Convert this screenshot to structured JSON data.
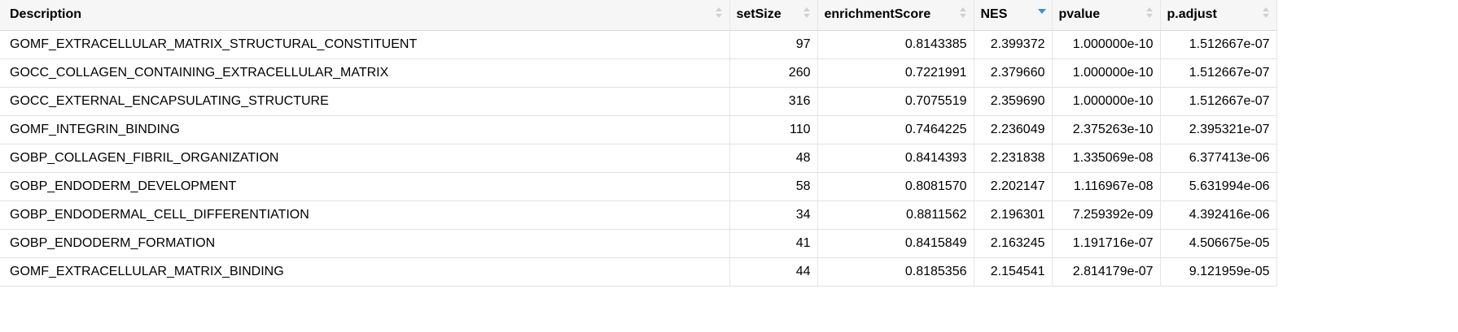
{
  "columns": {
    "description": "Description",
    "setSize": "setSize",
    "enrichmentScore": "enrichmentScore",
    "nes": "NES",
    "pvalue": "pvalue",
    "padjust": "p.adjust"
  },
  "sort": {
    "column": "NES",
    "direction": "descending"
  },
  "rows": [
    {
      "description": "GOMF_EXTRACELLULAR_MATRIX_STRUCTURAL_CONSTITUENT",
      "setSize": "97",
      "enrichmentScore": "0.8143385",
      "nes": "2.399372",
      "pvalue": "1.000000e-10",
      "padjust": "1.512667e-07"
    },
    {
      "description": "GOCC_COLLAGEN_CONTAINING_EXTRACELLULAR_MATRIX",
      "setSize": "260",
      "enrichmentScore": "0.7221991",
      "nes": "2.379660",
      "pvalue": "1.000000e-10",
      "padjust": "1.512667e-07"
    },
    {
      "description": "GOCC_EXTERNAL_ENCAPSULATING_STRUCTURE",
      "setSize": "316",
      "enrichmentScore": "0.7075519",
      "nes": "2.359690",
      "pvalue": "1.000000e-10",
      "padjust": "1.512667e-07"
    },
    {
      "description": "GOMF_INTEGRIN_BINDING",
      "setSize": "110",
      "enrichmentScore": "0.7464225",
      "nes": "2.236049",
      "pvalue": "2.375263e-10",
      "padjust": "2.395321e-07"
    },
    {
      "description": "GOBP_COLLAGEN_FIBRIL_ORGANIZATION",
      "setSize": "48",
      "enrichmentScore": "0.8414393",
      "nes": "2.231838",
      "pvalue": "1.335069e-08",
      "padjust": "6.377413e-06"
    },
    {
      "description": "GOBP_ENDODERM_DEVELOPMENT",
      "setSize": "58",
      "enrichmentScore": "0.8081570",
      "nes": "2.202147",
      "pvalue": "1.116967e-08",
      "padjust": "5.631994e-06"
    },
    {
      "description": "GOBP_ENDODERMAL_CELL_DIFFERENTIATION",
      "setSize": "34",
      "enrichmentScore": "0.8811562",
      "nes": "2.196301",
      "pvalue": "7.259392e-09",
      "padjust": "4.392416e-06"
    },
    {
      "description": "GOBP_ENDODERM_FORMATION",
      "setSize": "41",
      "enrichmentScore": "0.8415849",
      "nes": "2.163245",
      "pvalue": "1.191716e-07",
      "padjust": "4.506675e-05"
    },
    {
      "description": "GOMF_EXTRACELLULAR_MATRIX_BINDING",
      "setSize": "44",
      "enrichmentScore": "0.8185356",
      "nes": "2.154541",
      "pvalue": "2.814179e-07",
      "padjust": "9.121959e-05"
    }
  ]
}
